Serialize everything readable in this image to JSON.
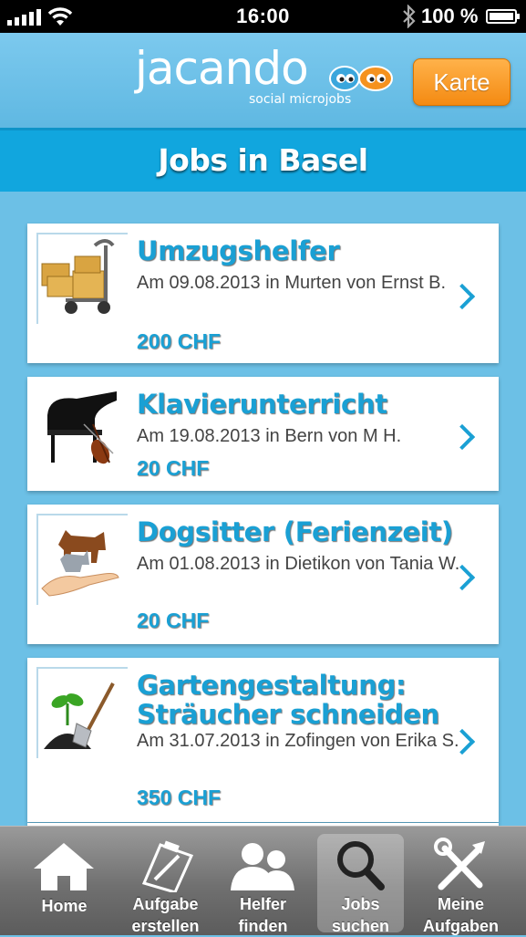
{
  "status_bar": {
    "time": "16:00",
    "battery": "100 %",
    "icons": [
      "signal-icon",
      "wifi-icon",
      "bluetooth-icon",
      "battery-icon"
    ]
  },
  "header": {
    "logo_word": "jacando",
    "logo_tagline": "social microjobs",
    "map_button": "Karte"
  },
  "page_title": "Jobs in Basel",
  "jobs": [
    {
      "title": "Umzugshelfer",
      "meta": "Am 09.08.2013 in Murten von Ernst B.",
      "price": "200 CHF",
      "icon": "hand-truck-boxes-icon"
    },
    {
      "title": "Klavierunterricht",
      "meta": "Am 19.08.2013 in Bern von M H.",
      "price": "20 CHF",
      "icon": "piano-violin-icon"
    },
    {
      "title": "Dogsitter (Ferienzeit)",
      "meta": "Am 01.08.2013 in Dietikon von Tania W.",
      "price": "20 CHF",
      "icon": "dog-cat-hand-icon"
    },
    {
      "title": "Gartengestaltung: Sträucher schneiden",
      "meta": "Am 31.07.2013 in Zofingen von Erika S.",
      "price": "350 CHF",
      "icon": "plant-shovel-icon"
    }
  ],
  "tabs": [
    {
      "line1": "Home",
      "line2": "",
      "icon": "home-icon",
      "active": false
    },
    {
      "line1": "Aufgabe",
      "line2": "erstellen",
      "icon": "clipboard-pencil-icon",
      "active": false
    },
    {
      "line1": "Helfer",
      "line2": "finden",
      "icon": "people-icon",
      "active": false
    },
    {
      "line1": "Jobs",
      "line2": "suchen",
      "icon": "search-icon",
      "active": true
    },
    {
      "line1": "Meine",
      "line2": "Aufgaben",
      "icon": "tools-icon",
      "active": false
    }
  ],
  "colors": {
    "accent": "#1aa0d4",
    "header_bg": "#6cc0e6",
    "title_band": "#11a6de",
    "map_button": "#f48a12"
  }
}
